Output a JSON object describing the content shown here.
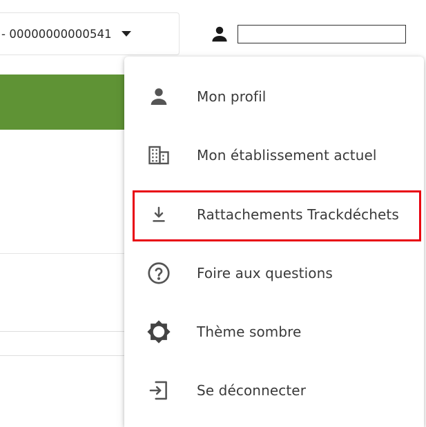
{
  "header": {
    "siret_select": {
      "value": "- 00000000000541"
    },
    "user": {
      "name": ""
    }
  },
  "menu": {
    "items": [
      {
        "label": "Mon profil",
        "icon": "person-icon"
      },
      {
        "label": "Mon établissement actuel",
        "icon": "building-icon"
      },
      {
        "label": "Rattachements Trackdéchets",
        "icon": "download-icon"
      },
      {
        "label": "Foire aux questions",
        "icon": "help-circle-icon"
      },
      {
        "label": "Thème sombre",
        "icon": "dark-theme-icon"
      },
      {
        "label": "Se déconnecter",
        "icon": "logout-icon"
      }
    ],
    "highlighted_index": 2
  },
  "colors": {
    "accent_green": "#5f9335",
    "highlight_red": "#e8000f",
    "icon_gray": "#4a4a4a"
  }
}
